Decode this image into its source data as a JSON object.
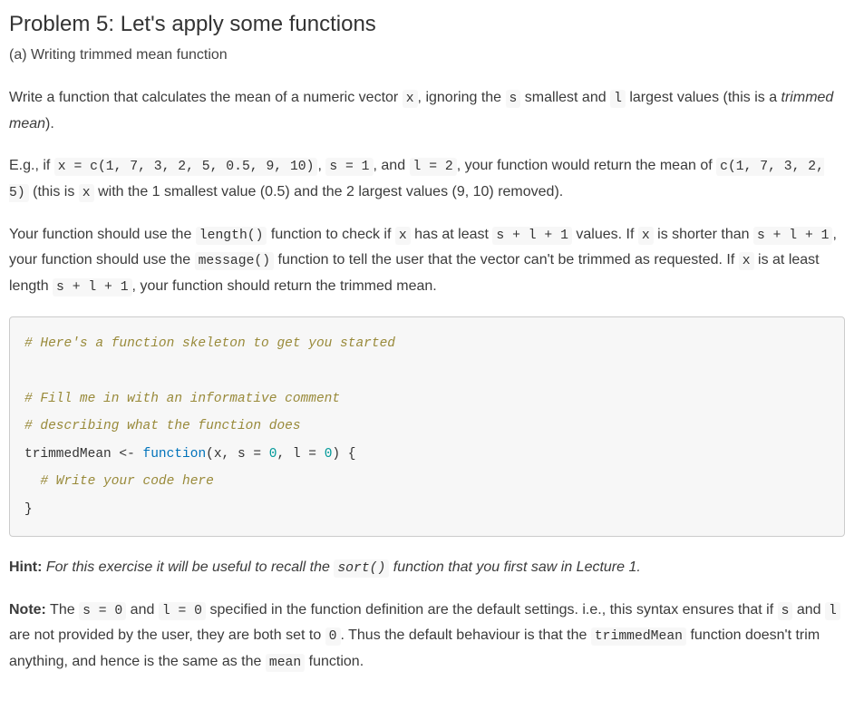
{
  "heading": "Problem 5: Let's apply some functions",
  "subtitle": "(a) Writing trimmed mean function",
  "p1": {
    "t1": "Write a function that calculates the mean of a numeric vector ",
    "c1": "x",
    "t2": ", ignoring the ",
    "c2": "s",
    "t3": " smallest and ",
    "c3": "l",
    "t4": " largest values (this is a ",
    "em": "trimmed mean",
    "t5": ")."
  },
  "p2": {
    "t1": "E.g., if ",
    "c1": "x = c(1, 7, 3, 2, 5, 0.5, 9, 10)",
    "t2": ", ",
    "c2": "s = 1",
    "t3": ", and ",
    "c3": "l = 2",
    "t4": ", your function would return the mean of ",
    "c4": "c(1, 7, 3, 2, 5)",
    "t5": " (this is ",
    "c5": "x",
    "t6": " with the 1 smallest value (0.5) and the 2 largest values (9, 10) removed)."
  },
  "p3": {
    "t1": "Your function should use the ",
    "c1": "length()",
    "t2": " function to check if ",
    "c2": "x",
    "t3": " has at least ",
    "c3": "s + l + 1",
    "t4": " values. If ",
    "c4": "x",
    "t5": " is shorter than ",
    "c5": "s + l + 1",
    "t6": ", your function should use the ",
    "c6": "message()",
    "t7": " function to tell the user that the vector can't be trimmed as requested. If ",
    "c7": "x",
    "t8": " is at least length ",
    "c8": "s + l + 1",
    "t9": ", your function should return the trimmed mean."
  },
  "code": {
    "l1": "# Here's a function skeleton to get you started",
    "l2": "",
    "l3": "# Fill me in with an informative comment",
    "l4": "# describing what the function does",
    "l5_a": "trimmedMean ",
    "l5_b": "<-",
    "l5_c": " ",
    "l5_d": "function",
    "l5_e": "(",
    "l5_f": "x, ",
    "l5_g": "s =",
    "l5_h": " 0",
    "l5_i": ", ",
    "l5_j": "l =",
    "l5_k": " 0",
    "l5_l": ") {",
    "l6": "  # Write your code here",
    "l7": "}"
  },
  "hint": {
    "label": "Hint:",
    "t1": " For this exercise it will be useful to recall the ",
    "c1": "sort()",
    "t2": " function that you first saw in Lecture 1."
  },
  "note": {
    "label": "Note:",
    "t1": " The ",
    "c1": "s = 0",
    "t2": " and ",
    "c2": "l = 0",
    "t3": " specified in the function definition are the default settings. i.e., this syntax ensures that if ",
    "c3": "s",
    "t4": " and ",
    "c4": "l",
    "t5": " are not provided by the user, they are both set to ",
    "c5": "0",
    "t6": ". Thus the default behaviour is that the ",
    "c6": "trimmedMean",
    "t7": " function doesn't trim anything, and hence is the same as the ",
    "c7": "mean",
    "t8": " function."
  }
}
